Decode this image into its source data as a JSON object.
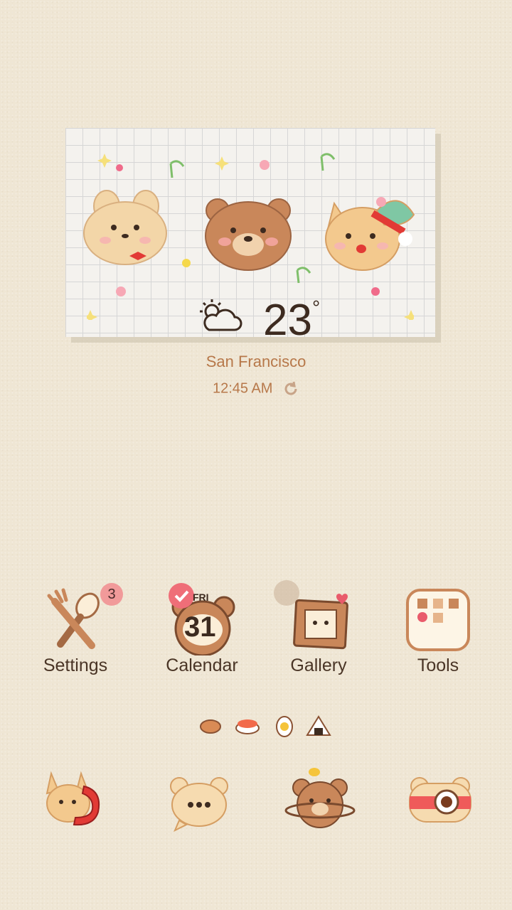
{
  "widget": {
    "temperature": "23",
    "degree_symbol": "°",
    "weather_icon": "partly-cloudy-icon",
    "city": "San Francisco",
    "time": "12:45 AM"
  },
  "apps": [
    {
      "label": "Settings",
      "icon": "spoon-fork-icon",
      "badge": "3"
    },
    {
      "label": "Calendar",
      "icon": "bear-calendar-icon",
      "day_name": "FRI",
      "day_number": "31"
    },
    {
      "label": "Gallery",
      "icon": "picture-frame-icon"
    },
    {
      "label": "Tools",
      "icon": "tools-folder-icon"
    }
  ],
  "page_indicator": {
    "count": 4,
    "icons": [
      "fish-cake-icon",
      "sushi-icon",
      "egg-icon",
      "onigiri-icon"
    ]
  },
  "dock": [
    {
      "name": "phone",
      "icon": "cat-phone-icon"
    },
    {
      "name": "messages",
      "icon": "bear-message-icon"
    },
    {
      "name": "browser",
      "icon": "bear-planet-icon"
    },
    {
      "name": "camera",
      "icon": "bear-camera-icon"
    }
  ],
  "colors": {
    "background": "#efe6d4",
    "text_brown": "#4a3526",
    "accent_orange": "#b7784a",
    "badge_pink": "#f19a9a"
  }
}
